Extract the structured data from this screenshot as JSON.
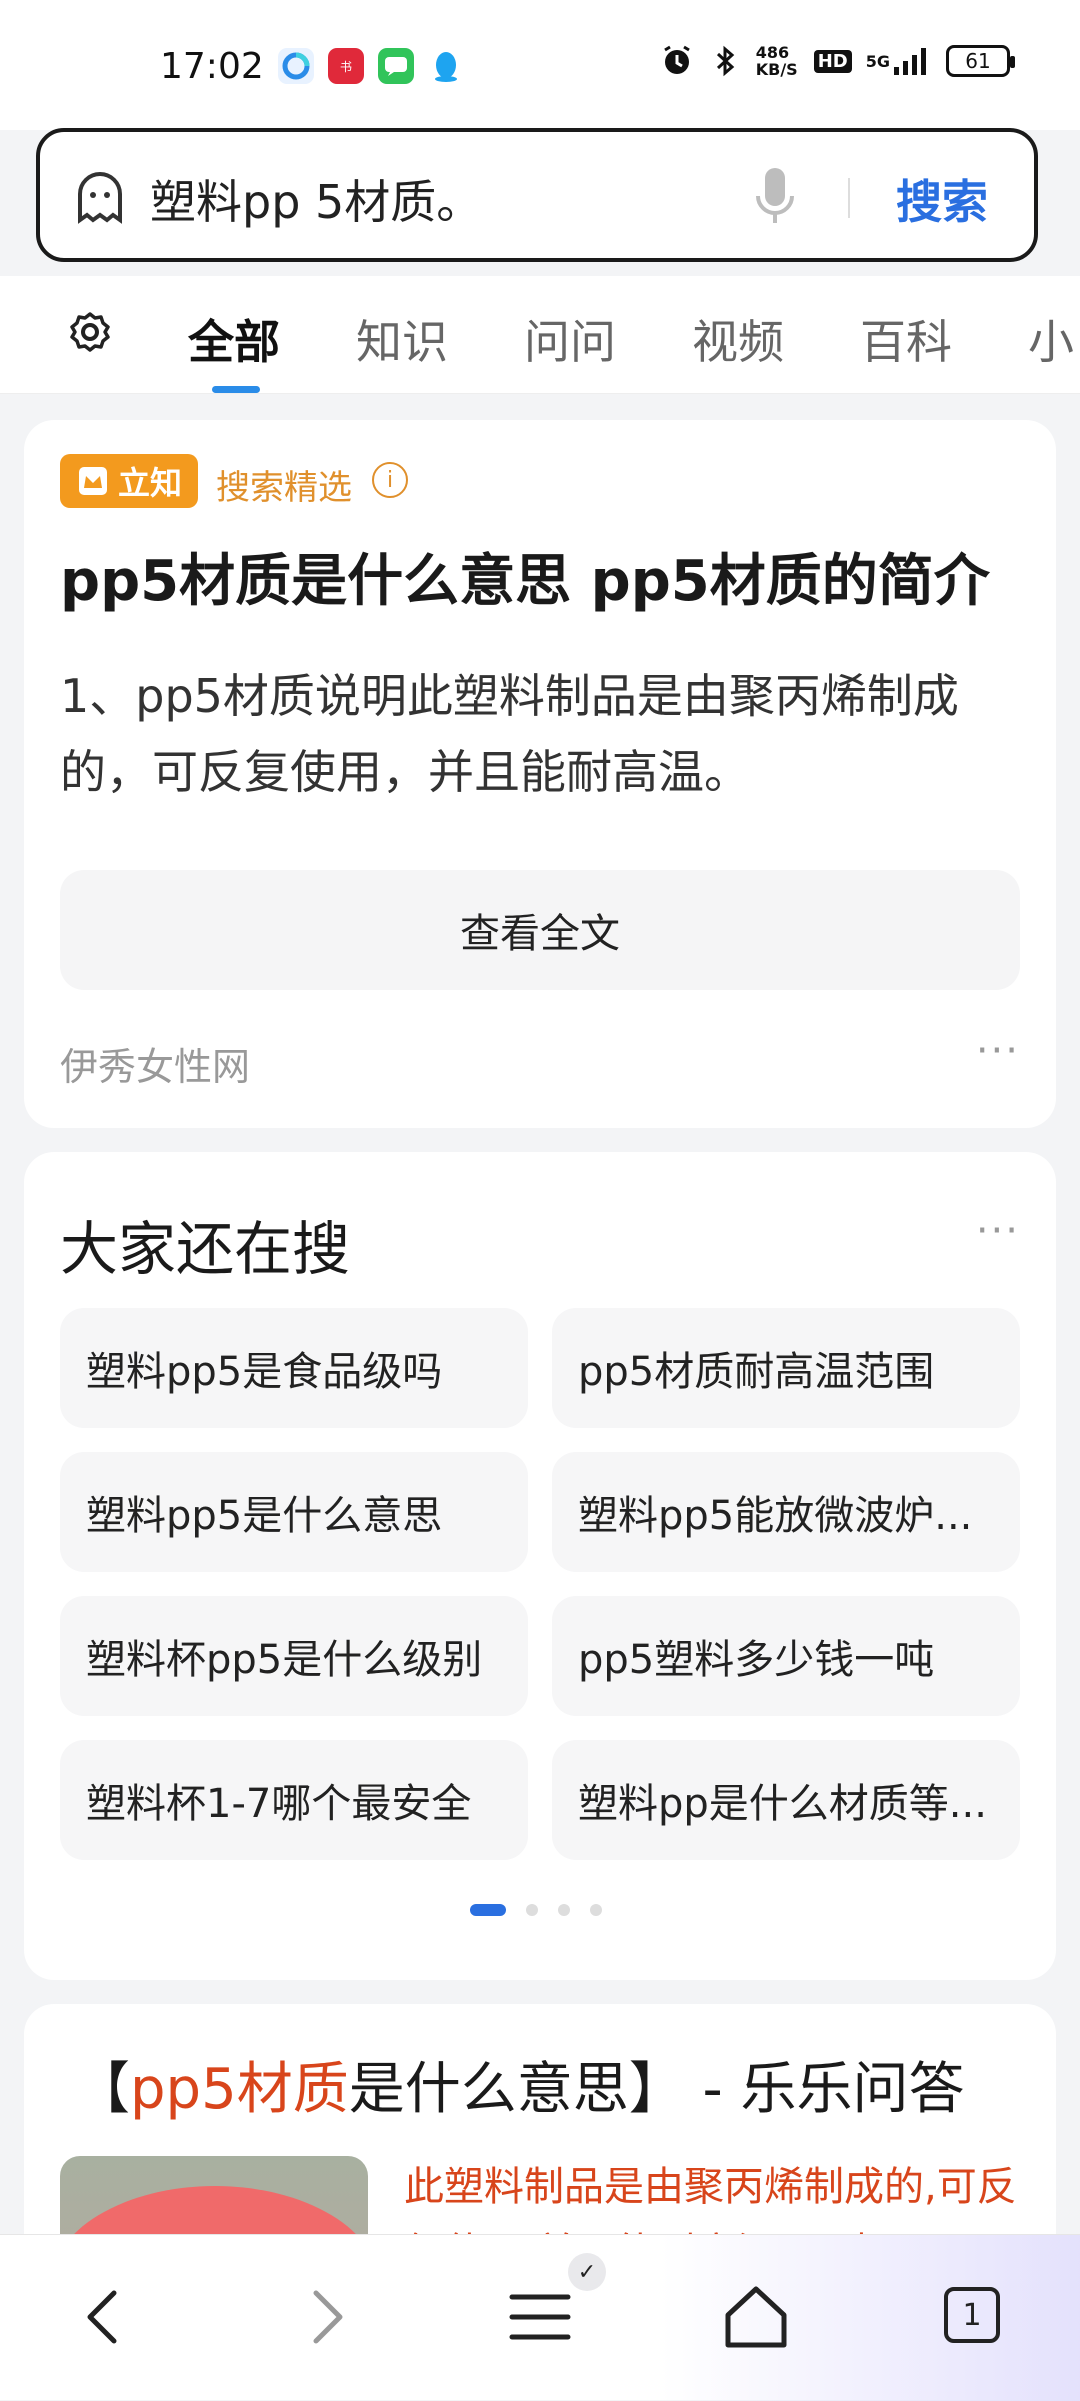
{
  "status": {
    "time": "17:02",
    "network_speed": "486 KB/S",
    "hd": "HD",
    "signal": "5G",
    "battery": "61"
  },
  "search": {
    "query": "塑料pp 5材质。",
    "button": "搜索"
  },
  "tabs": [
    "全部",
    "知识",
    "问问",
    "视频",
    "百科",
    "小"
  ],
  "result1": {
    "badge": "立知",
    "selection": "搜索精选",
    "title": "pp5材质是什么意思 pp5材质的简介",
    "body": "1、pp5材质说明此塑料制品是由聚丙烯制成的，可反复使用，并且能耐高温。",
    "button": "查看全文",
    "source": "伊秀女性网",
    "more": "···"
  },
  "related": {
    "title": "大家还在搜",
    "more": "···",
    "items": [
      "塑料pp5是食品级吗",
      "pp5材质耐高温范围",
      "塑料pp5是什么意思",
      "塑料pp5能放微波炉...",
      "塑料杯pp5是什么级别",
      "pp5塑料多少钱一吨",
      "塑料杯1-7哪个最安全",
      "塑料pp是什么材质等..."
    ]
  },
  "result3": {
    "title_open": "【",
    "title_highlight": "pp5材质",
    "title_rest": "是什么意思】 - 乐乐问答",
    "snippet": "此塑料制品是由聚丙烯制成的,可反复使用,并且能耐高温。 对于"
  },
  "bottom": {
    "tab_count": "1",
    "colors": {
      "accent": "#2a6fe0",
      "highlight": "#d8451b"
    }
  }
}
